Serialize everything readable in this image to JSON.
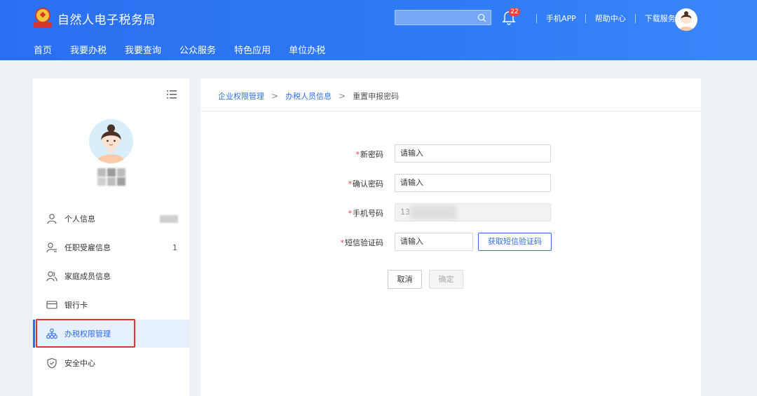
{
  "header": {
    "title": "自然人电子税务局",
    "notification_count": "22",
    "links": [
      "手机APP",
      "帮助中心",
      "下载服务"
    ],
    "nav": [
      "首页",
      "我要办税",
      "我要查询",
      "公众服务",
      "特色应用",
      "单位办税"
    ]
  },
  "sidebar": {
    "items": [
      {
        "label": "个人信息",
        "icon": "user-icon",
        "value": ""
      },
      {
        "label": "任职受雇信息",
        "icon": "employment-icon",
        "value": "1"
      },
      {
        "label": "家庭成员信息",
        "icon": "family-icon",
        "value": ""
      },
      {
        "label": "银行卡",
        "icon": "bank-card-icon",
        "value": ""
      },
      {
        "label": "办税权限管理",
        "icon": "org-tree-icon",
        "value": "",
        "active": true
      },
      {
        "label": "安全中心",
        "icon": "shield-icon",
        "value": ""
      }
    ]
  },
  "breadcrumb": {
    "items": [
      "企业权限管理",
      "办税人员信息",
      "重置申报密码"
    ]
  },
  "form": {
    "new_password": {
      "label": "新密码",
      "value": "请输入"
    },
    "confirm_password": {
      "label": "确认密码",
      "value": "请输入"
    },
    "phone": {
      "label": "手机号码",
      "value": "13"
    },
    "sms_code": {
      "label": "短信验证码",
      "value": "请输入"
    },
    "required_mark": "*",
    "get_sms_label": "获取短信验证码",
    "cancel_label": "取消",
    "confirm_label": "确定"
  },
  "colors": {
    "header_blue": "#2f7bf5",
    "accent": "#2f6fe8",
    "required": "#f5403b",
    "highlight": "#e5322d"
  }
}
